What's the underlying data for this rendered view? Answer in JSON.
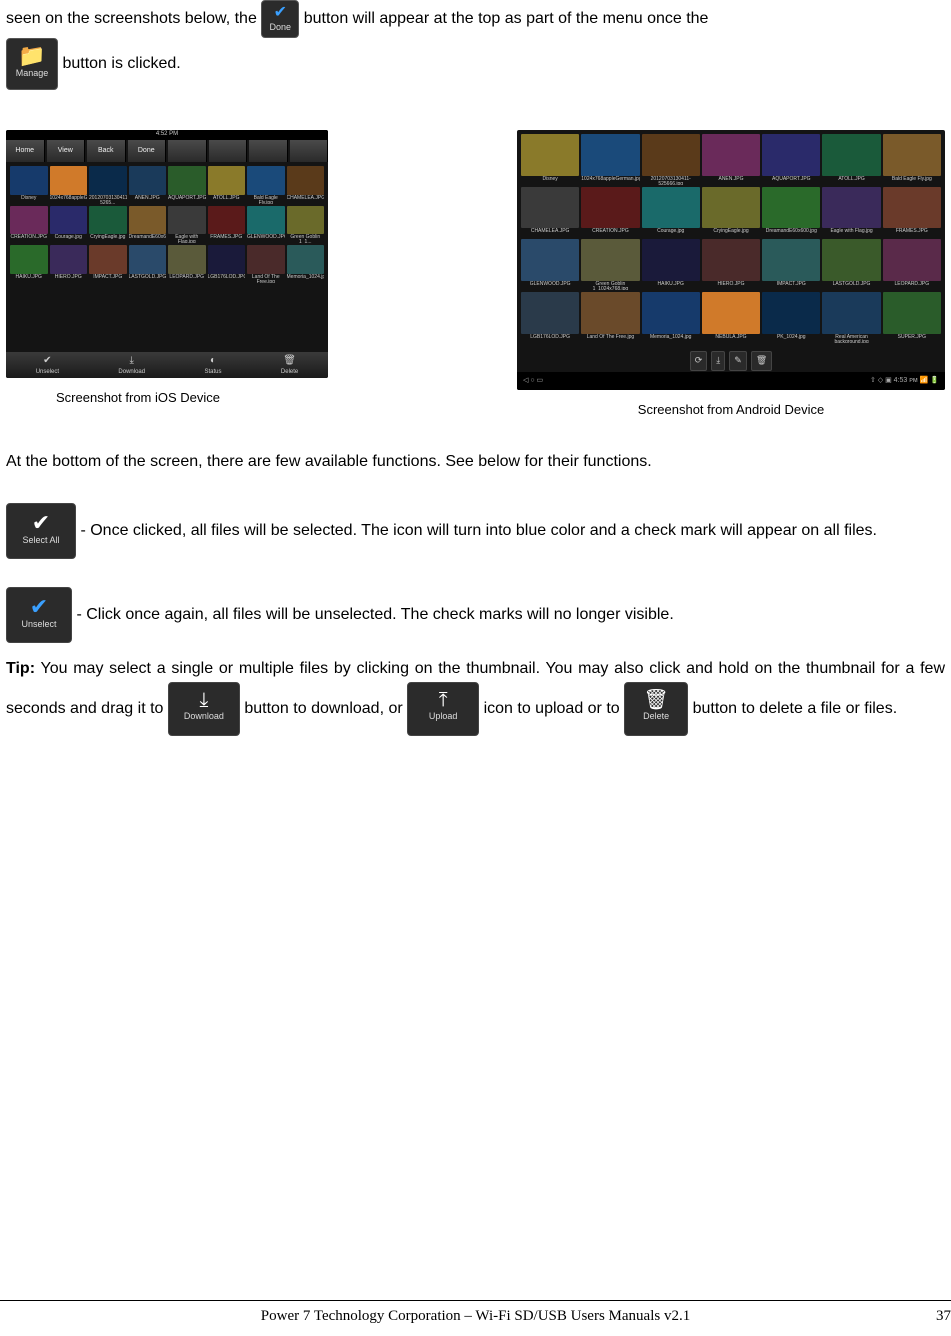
{
  "para1": {
    "t1": "seen on the screenshots below, the ",
    "t2": " button will appear at the top as part of the menu once the ",
    "t3": " button is clicked."
  },
  "icons": {
    "done": "Done",
    "manage": "Manage",
    "selectall": "Select All",
    "unselect": "Unselect",
    "download": "Download",
    "upload": "Upload",
    "delete": "Delete"
  },
  "ios_screenshot": {
    "caption": "Screenshot from iOS Device",
    "topbar": [
      "Home",
      "View",
      "Back",
      "Done",
      "",
      "",
      "",
      ""
    ],
    "statusbar_time": "4:52 PM",
    "thumbs": [
      "Disney",
      "1024x768appleGerman.jpg",
      "20120703130411-5265...",
      "ANEN.JPG",
      "AQUAPORT.JPG",
      "ATOLL.JPG",
      "Bald Eagle Fly.jpg",
      "CHAMELEA.JPG",
      "CREATION.JPG",
      "Courage.jpg",
      "CryingEagle.jpg",
      "DreamandE60x600.jpg",
      "Eagle with Flag.jpg",
      "FRAMES.JPG",
      "GLENWOOD.JPG",
      "Green Goblin 1_1...",
      "HAIKU.JPG",
      "HIERO.JPG",
      "IMPACT.JPG",
      "LASTGOLD.JPG",
      "LEOPARD.JPG",
      "LGB176LOD.JPG",
      "Land Of The Free.jpg",
      "Memoria_1024.jpg"
    ],
    "bottombar": [
      "Unselect",
      "Download",
      "Status",
      "Delete"
    ]
  },
  "android_screenshot": {
    "caption": "Screenshot from Android Device",
    "thumbs": [
      "Disney",
      "1024x768appleGerman.jpg",
      "20120703130411-525666.jpg",
      "ANEN.JPG",
      "AQUAPORT.JPG",
      "ATOLL.JPG",
      "Bald Eagle Fly.jpg",
      "CHAMELEA.JPG",
      "CREATION.JPG",
      "Courage.jpg",
      "CryingEagle.jpg",
      "DreamandE60x600.jpg",
      "Eagle with Flag.jpg",
      "FRAMES.JPG",
      "GLENWOOD.JPG",
      "Green Goblin 1_1024x768.jpg",
      "HAIKU.JPG",
      "HIERO.JPG",
      "IMPACT.JPG",
      "LASTGOLD.JPG",
      "LEOPARD.JPG",
      "LGB176LOD.JPG",
      "Land Of The Free.jpg",
      "Memoria_1024.jpg",
      "NEBULA.JPG",
      "PK_1024.jpg",
      "Real American background.jpg",
      "SUPER.JPG"
    ],
    "midtools": [
      "⟳",
      "⤓",
      "✎",
      "🗑"
    ],
    "sysbar_left": "◁  ○  ▭",
    "sysbar_right": "⇧ ◇ ▣ 4:53 ᴘᴍ 📶 🔋"
  },
  "para2": "At the bottom of the screen, there are few available functions.    See below for their functions.",
  "selectall_text": " - Once clicked, all files will be selected.    The icon will turn into blue color and a check mark will appear on all files.",
  "unselect_text": "- Click once again, all files will be unselected.    The check marks will no longer visible.",
  "tip": {
    "label": "Tip:",
    "t1": " You may select a single or multiple files by clicking on the thumbnail.    You may also click and hold on the thumbnail for a few seconds and drag it to ",
    "t2": " button to download, or ",
    "t3": " icon to upload or to ",
    "t4": " button to delete a file or files."
  },
  "footer": {
    "center": "Power 7 Technology Corporation – Wi-Fi SD/USB Users Manuals v2.1",
    "page": "37"
  },
  "thumb_colors": [
    "#163a6b",
    "#d07a2a",
    "#0a2a4a",
    "#1a3a5a",
    "#2a5c2a",
    "#8a7a2a",
    "#1a4a7a",
    "#5a3a1a",
    "#6a2a5a",
    "#2a2a6a",
    "#1a5a3a",
    "#7a5a2a",
    "#3a3a3a",
    "#5a1a1a",
    "#1a6a6a",
    "#6a6a2a",
    "#2a6a2a",
    "#3a2a5a",
    "#6a3a2a",
    "#2a4a6a",
    "#5a5a3a",
    "#1a1a3a",
    "#4a2a2a",
    "#2a5a5a",
    "#3a5a2a",
    "#5a2a4a",
    "#2a3a4a",
    "#6a4a2a"
  ]
}
